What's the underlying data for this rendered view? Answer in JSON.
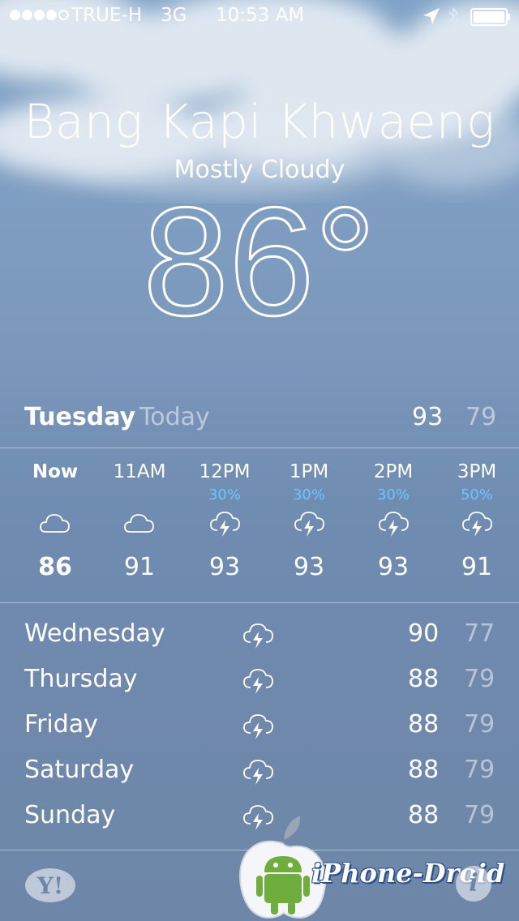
{
  "status_bar": {
    "carrier": "TRUE-H",
    "network": "3G",
    "time": "10:53 AM"
  },
  "location": {
    "city": "Bang Kapi Khwaeng",
    "condition": "Mostly Cloudy",
    "temperature": "86°"
  },
  "today": {
    "day": "Tuesday",
    "label": "Today",
    "high": "93",
    "low": "79"
  },
  "hourly": [
    {
      "time": "Now",
      "precip": "",
      "icon": "cloud-icon",
      "temp": "86"
    },
    {
      "time": "11AM",
      "precip": "",
      "icon": "cloud-icon",
      "temp": "91"
    },
    {
      "time": "12PM",
      "precip": "30%",
      "icon": "thunderstorm-icon",
      "temp": "93"
    },
    {
      "time": "1PM",
      "precip": "30%",
      "icon": "thunderstorm-icon",
      "temp": "93"
    },
    {
      "time": "2PM",
      "precip": "30%",
      "icon": "thunderstorm-icon",
      "temp": "93"
    },
    {
      "time": "3PM",
      "precip": "50%",
      "icon": "thunderstorm-icon",
      "temp": "91"
    }
  ],
  "daily": [
    {
      "day": "Wednesday",
      "icon": "thunderstorm-icon",
      "high": "90",
      "low": "77"
    },
    {
      "day": "Thursday",
      "icon": "thunderstorm-icon",
      "high": "88",
      "low": "79"
    },
    {
      "day": "Friday",
      "icon": "thunderstorm-icon",
      "high": "88",
      "low": "79"
    },
    {
      "day": "Saturday",
      "icon": "thunderstorm-icon",
      "high": "88",
      "low": "79"
    },
    {
      "day": "Sunday",
      "icon": "thunderstorm-icon",
      "high": "88",
      "low": "79"
    }
  ],
  "footer": {
    "provider_logo": "Y!",
    "info_label": "i",
    "watermark": "iPhone-Droid"
  },
  "colors": {
    "precip_text": "#6fc4ff",
    "background_top": "#7ea2c6",
    "background_bottom": "#6e87a8"
  }
}
